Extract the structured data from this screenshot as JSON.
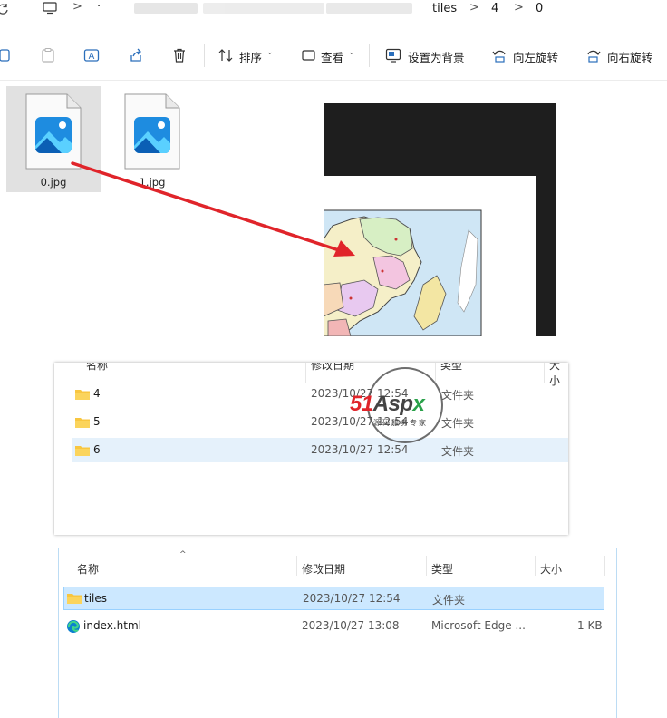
{
  "address_bar": {
    "breadcrumb": [
      "tiles",
      "4",
      "0"
    ],
    "separator": ">"
  },
  "command_bar": {
    "sort_label": "排序",
    "view_label": "查看",
    "set_background_label": "设置为背景",
    "rotate_left_label": "向左旋转",
    "rotate_right_label": "向右旋转"
  },
  "files": [
    {
      "name": "0.jpg",
      "selected": true
    },
    {
      "name": "1.jpg",
      "selected": false
    }
  ],
  "folder_list_1": {
    "headers": {
      "name": "名称",
      "date": "修改日期",
      "type": "类型",
      "size": "大小"
    },
    "rows": [
      {
        "name": "4",
        "date": "2023/10/27 12:54",
        "type": "文件夹"
      },
      {
        "name": "5",
        "date": "2023/10/27 12:54",
        "type": "文件夹"
      },
      {
        "name": "6",
        "date": "2023/10/27 12:54",
        "type": "文件夹"
      }
    ]
  },
  "folder_list_2": {
    "headers": {
      "name": "名称",
      "date": "修改日期",
      "type": "类型",
      "size": "大小"
    },
    "rows": [
      {
        "name": "tiles",
        "date": "2023/10/27 12:54",
        "type": "文件夹",
        "size": ""
      },
      {
        "name": "index.html",
        "date": "2023/10/27 13:08",
        "type": "Microsoft Edge ...",
        "size": "1 KB"
      }
    ]
  },
  "watermark": {
    "brand": "51Aspx",
    "tagline": "源码服务专家"
  },
  "colors": {
    "accent": "#0078d4",
    "selected_row": "#cce8ff",
    "arrow": "#e0242a",
    "folder": "#f8c640"
  }
}
